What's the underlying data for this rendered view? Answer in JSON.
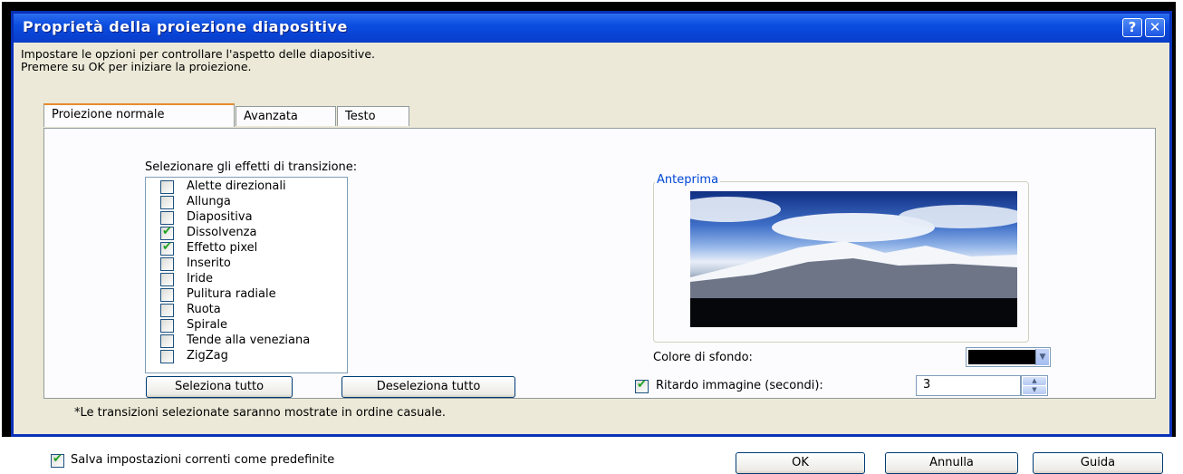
{
  "window": {
    "title": "Proprietà della proiezione diapositive",
    "help_glyph": "?",
    "close_glyph": "✕"
  },
  "intro": {
    "line1": "Impostare le opzioni per controllare l'aspetto delle diapositive.",
    "line2": "Premere su OK per iniziare la proiezione."
  },
  "tabs": [
    {
      "label": "Proiezione normale",
      "active": true
    },
    {
      "label": "Avanzata",
      "active": false
    },
    {
      "label": "Testo",
      "active": false
    }
  ],
  "transitions": {
    "label": "Selezionare gli effetti di transizione:",
    "items": [
      {
        "label": "Alette direzionali",
        "checked": false
      },
      {
        "label": "Allunga",
        "checked": false
      },
      {
        "label": "Diapositiva",
        "checked": false
      },
      {
        "label": "Dissolvenza",
        "checked": true
      },
      {
        "label": "Effetto pixel",
        "checked": true
      },
      {
        "label": "Inserito",
        "checked": false
      },
      {
        "label": "Iride",
        "checked": false
      },
      {
        "label": "Pulitura radiale",
        "checked": false
      },
      {
        "label": "Ruota",
        "checked": false
      },
      {
        "label": "Spirale",
        "checked": false
      },
      {
        "label": "Tende alla veneziana",
        "checked": false
      },
      {
        "label": "ZigZag",
        "checked": false
      }
    ],
    "select_all": "Seleziona tutto",
    "deselect_all": "Deseleziona tutto",
    "note": "*Le transizioni selezionate saranno mostrate in ordine casuale."
  },
  "preview": {
    "group_label": "Anteprima"
  },
  "background": {
    "label": "Colore di sfondo:",
    "color": "#000000"
  },
  "delay": {
    "label": "Ritardo immagine (secondi):",
    "checked": true,
    "value": "3"
  },
  "footer": {
    "save_default_label": "Salva impostazioni correnti come predefinite",
    "save_default_checked": true,
    "ok": "OK",
    "cancel": "Annulla",
    "help": "Guida"
  }
}
